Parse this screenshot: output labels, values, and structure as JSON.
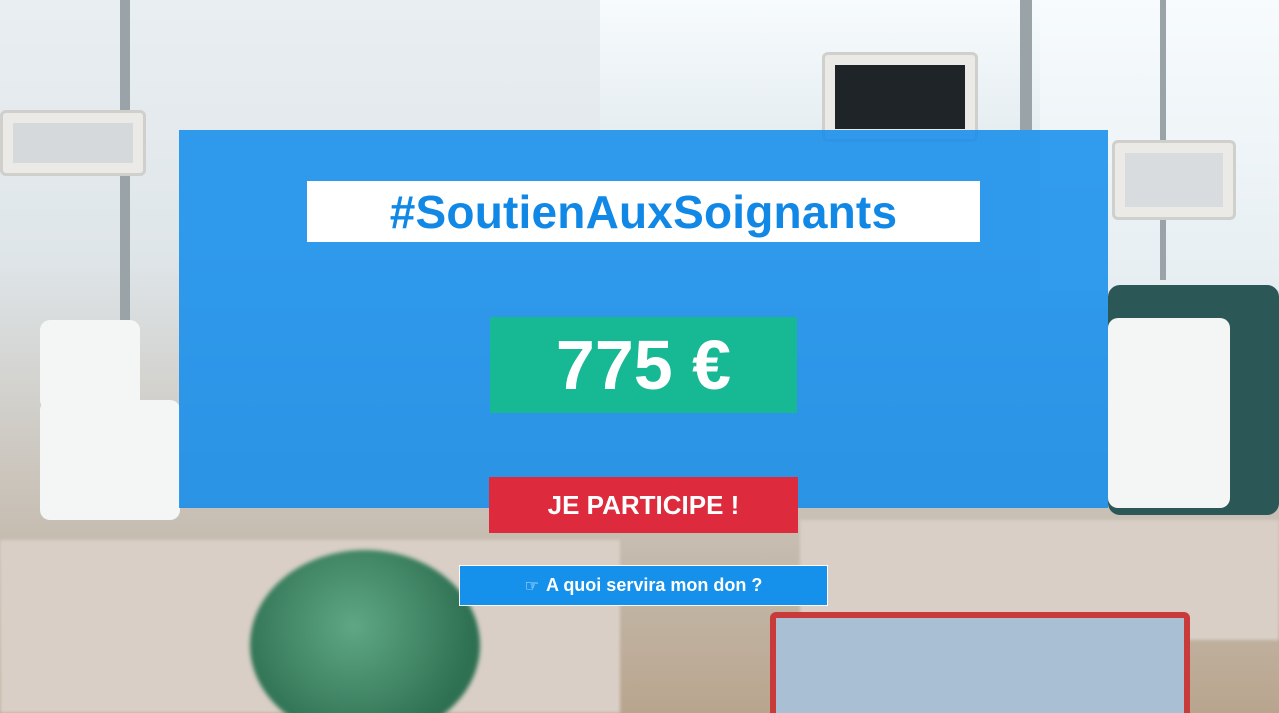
{
  "hero": {
    "hashtag": "#SoutienAuxSoignants",
    "amount": "775 €",
    "cta_label": "JE PARTICIPE !",
    "info_icon": "pointing-hand-icon",
    "info_icon_glyph": "☞",
    "info_label": "A quoi servira mon don ?"
  },
  "colors": {
    "panel_blue": "#128CEB",
    "hashtag_text": "#1188E6",
    "amount_green": "#17B894",
    "cta_red": "#DD2A3C",
    "info_blue": "#1591EC"
  }
}
